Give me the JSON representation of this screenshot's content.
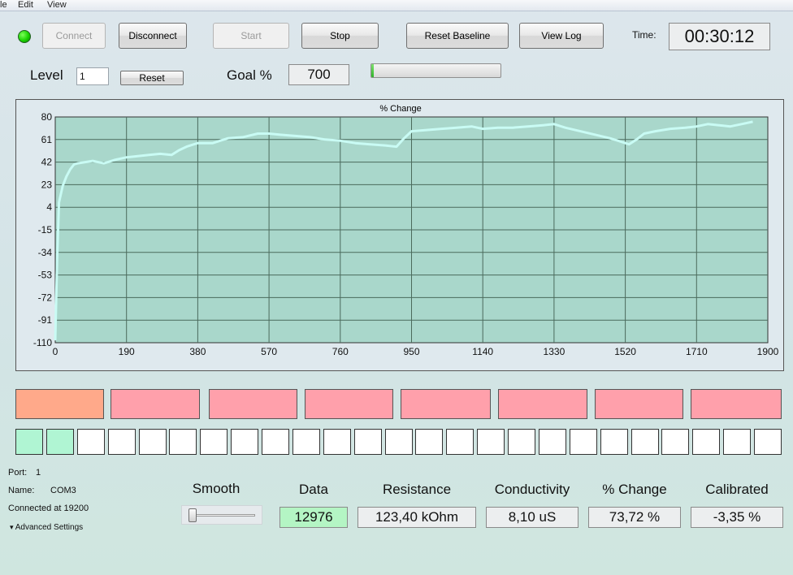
{
  "menu": {
    "file": "le",
    "edit": "Edit",
    "view": "View"
  },
  "toolbar": {
    "connect": "Connect",
    "disconnect": "Disconnect",
    "start": "Start",
    "stop": "Stop",
    "reset_baseline": "Reset Baseline",
    "view_log": "View Log",
    "time_label": "Time:",
    "time_value": "00:30:12"
  },
  "level": {
    "label": "Level",
    "value": "1",
    "reset": "Reset"
  },
  "goal": {
    "label": "Goal %",
    "value": "700",
    "progress": 0.02
  },
  "colors": {
    "plot_bg": "#a9d7cb",
    "line": "#c9fbf4",
    "grid": "#4b6a5c",
    "led": "#19d200",
    "tile_orange": "#ffa98a",
    "tile_pink": "#ffa0ab",
    "square_green": "#b0f5d3",
    "data_green": "#b4f5c4"
  },
  "chart_data": {
    "type": "line",
    "title": "% Change",
    "xlabel": "",
    "ylabel": "",
    "xlim": [
      0,
      1900
    ],
    "ylim": [
      -110,
      80
    ],
    "xticks": [
      "0",
      "190",
      "380",
      "570",
      "760",
      "950",
      "1140",
      "1330",
      "1520",
      "1710",
      "1900"
    ],
    "yticks": [
      "80",
      "61",
      "42",
      "23",
      "4",
      "-15",
      "-34",
      "-53",
      "-72",
      "-91",
      "-110"
    ],
    "grid": true,
    "series": [
      {
        "x": [
          0,
          5,
          10,
          15,
          20,
          30,
          40,
          50,
          60,
          80,
          100,
          130,
          160,
          190,
          220,
          250,
          280,
          310,
          330,
          350,
          380,
          420,
          460,
          500,
          540,
          570,
          600,
          640,
          680,
          720,
          760,
          800,
          840,
          880,
          910,
          930,
          950,
          990,
          1030,
          1070,
          1110,
          1140,
          1180,
          1220,
          1260,
          1300,
          1330,
          1360,
          1400,
          1440,
          1480,
          1510,
          1530,
          1550,
          1570,
          1600,
          1640,
          1680,
          1710,
          1740,
          1770,
          1800,
          1830,
          1860
        ],
        "y": [
          -108,
          -40,
          8,
          15,
          22,
          30,
          36,
          40,
          41,
          42,
          43,
          41,
          44,
          46,
          47,
          48,
          49,
          48,
          52,
          55,
          58,
          58,
          62,
          63,
          66,
          66,
          65,
          64,
          63,
          61,
          60,
          58,
          57,
          56,
          55,
          62,
          68,
          69,
          70,
          71,
          72,
          70,
          71,
          71,
          72,
          73,
          74,
          71,
          68,
          65,
          62,
          59,
          57,
          61,
          66,
          68,
          70,
          71,
          72,
          74,
          73,
          72,
          74,
          76
        ]
      }
    ]
  },
  "indicators": {
    "tiles": [
      "orange",
      "pink",
      "pink",
      "pink",
      "pink",
      "pink",
      "pink",
      "pink"
    ],
    "squares_lit": 2,
    "squares_total": 25
  },
  "port": {
    "port_label": "Port:",
    "port_value": "1",
    "name_label": "Name:",
    "name_value": "COM3",
    "status": "Connected at 19200",
    "advanced": "Advanced Settings"
  },
  "meters": {
    "smooth_label": "Smooth",
    "smooth_value": 0,
    "data_label": "Data",
    "data_value": "12976",
    "resistance_label": "Resistance",
    "resistance_value": "123,40 kOhm",
    "conductivity_label": "Conductivity",
    "conductivity_value": "8,10 uS",
    "change_label": "% Change",
    "change_value": "73,72 %",
    "calibrated_label": "Calibrated",
    "calibrated_value": "-3,35 %"
  }
}
